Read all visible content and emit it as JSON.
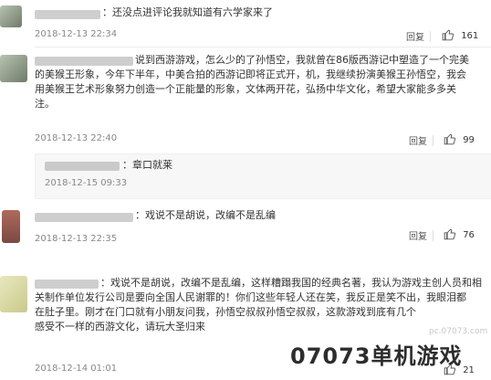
{
  "comments": [
    {
      "text": "：还没点进评论我就知道有六学家来了",
      "date": "2018-12-13 22:34",
      "reply_label": "回复",
      "likes": "161"
    },
    {
      "text_lines": [
        "说到西游游戏，怎么少的了孙悟空，我就曾在86版西游记中塑造了一个完美",
        "的美猴王形象，今年下半年，中美合拍的西游记即将正式开，机，我继续扮演美猴王孙悟空，我会",
        "用美猴王艺术形象努力创造一个正能量的形象，文体两开花，弘扬中华文化，希望大家能多多关",
        "注。"
      ],
      "date": "2018-12-13 22:40",
      "reply_label": "回复",
      "likes": "99"
    },
    {
      "text": "：章口就莱",
      "date": "2018-12-15 09:33"
    },
    {
      "text": "：戏说不是胡说，改编不是乱编",
      "date": "2018-12-13 22:35",
      "reply_label": "回复",
      "likes": "76"
    },
    {
      "text_lines": [
        "：戏说不是胡说，改编不是乱编，这样糟蹋我国的经典名著，我认为游戏主创人员和相",
        "关制作单位发行公司是要向全国人民谢罪的！你们这些年轻人还在笑，我反正是笑不出，我眼泪都",
        "在肚子里。刚才在门口就有小朋友问我，孙悟空叔叔孙悟空叔叔，这款游戏到底有几个",
        "感受不一样的西游文化，请玩大圣归来"
      ],
      "date": "2018-12-14 01:01",
      "likes": "21"
    }
  ],
  "watermark": {
    "url": "pc.07073.com",
    "brand": "07073单机游戏"
  }
}
